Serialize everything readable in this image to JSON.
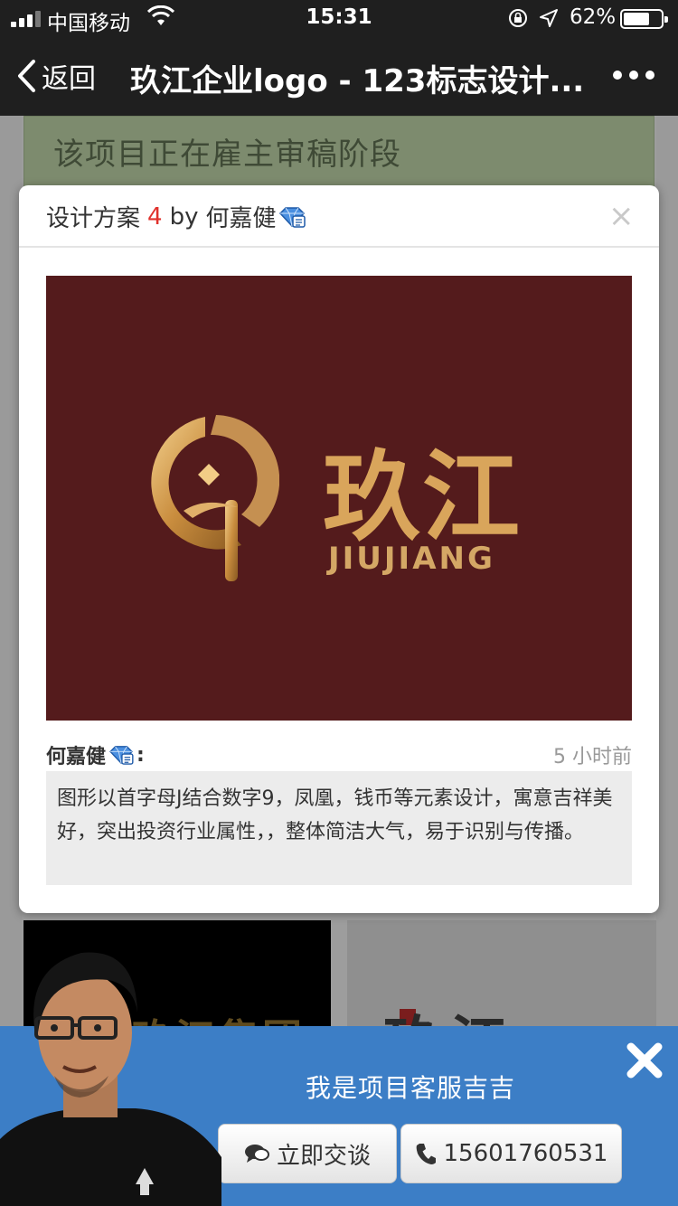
{
  "status": {
    "carrier": "中国移动",
    "time": "15:31",
    "battery_pct": "62%",
    "battery_level": 0.62,
    "signal_bars": 3
  },
  "nav": {
    "back_label": "返回",
    "title": "玖江企业logo - 123标志设计...",
    "icons": {
      "back": "chevron-left-icon",
      "more": "more-dots-icon"
    }
  },
  "background": {
    "banner": "该项目正在雇主审稿阶段",
    "thumb1_text": "玖江集团",
    "thumb2_text": "玖江"
  },
  "modal": {
    "title_prefix": "设计方案",
    "number": "4",
    "by": "by",
    "designer": "何嘉健",
    "close": "×",
    "design_text_cn": "玖江",
    "design_text_en": "JIUJIANG",
    "author": "何嘉健",
    "colon": ":",
    "time_ago": "5 小时前",
    "description": "图形以首字母J结合数字9，凤凰，钱币等元素设计，寓意吉祥美好，突出投资行业属性，，整体简洁大气，易于识别与传播。",
    "colors": {
      "number": "#e0312c",
      "design_bg": "#541b1c",
      "gold": "#d9a55b"
    }
  },
  "chat": {
    "message": "我是项目客服吉吉",
    "talk_button": "立即交谈",
    "phone_button": "15601760531",
    "bg_color": "#3c7ec6",
    "icons": {
      "talk": "chat-bubble-icon",
      "phone": "phone-icon",
      "close": "close-icon"
    }
  }
}
